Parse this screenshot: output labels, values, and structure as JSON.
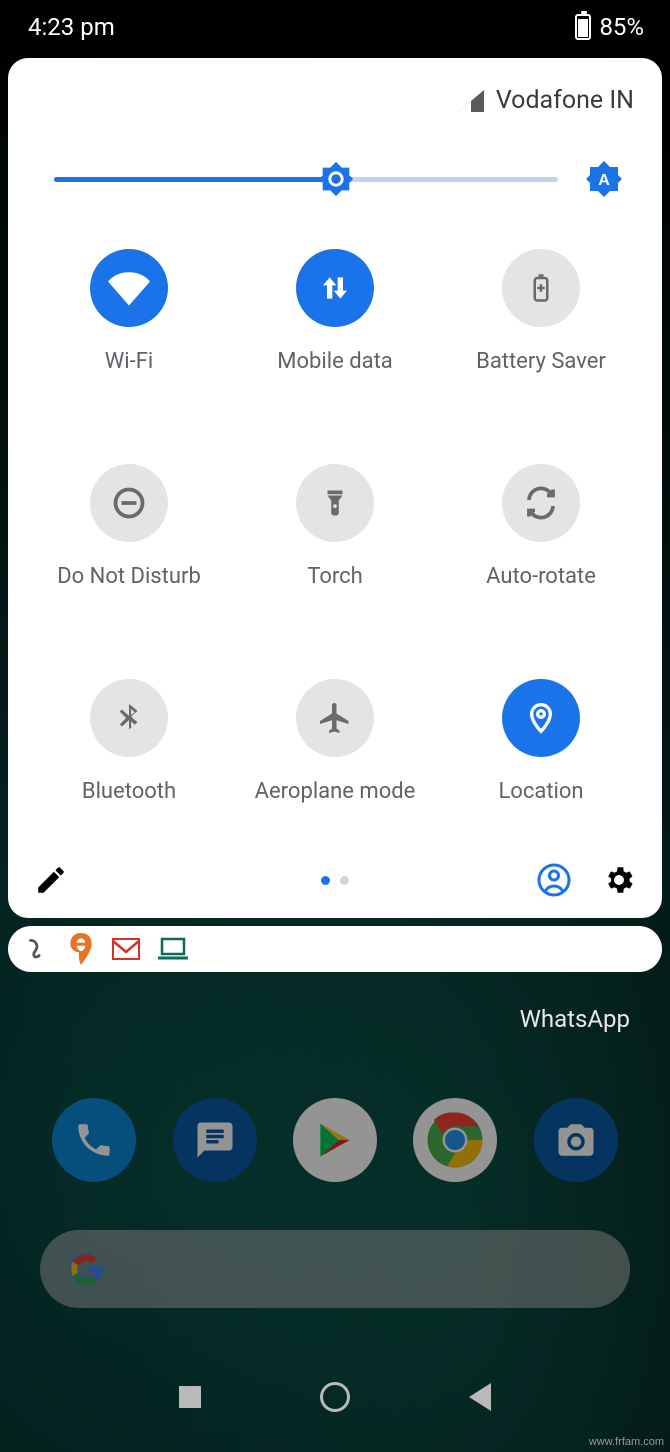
{
  "status": {
    "time": "4:23 pm",
    "battery_pct": "85%"
  },
  "carrier": "Vodafone IN",
  "brightness": {
    "percent": 56
  },
  "tiles": [
    {
      "key": "wifi",
      "label": "Wi-Fi",
      "enabled": true
    },
    {
      "key": "mobile-data",
      "label": "Mobile data",
      "enabled": true
    },
    {
      "key": "battery-saver",
      "label": "Battery Saver",
      "enabled": false
    },
    {
      "key": "dnd",
      "label": "Do Not Disturb",
      "enabled": false
    },
    {
      "key": "torch",
      "label": "Torch",
      "enabled": false
    },
    {
      "key": "auto-rotate",
      "label": "Auto-rotate",
      "enabled": false
    },
    {
      "key": "bluetooth",
      "label": "Bluetooth",
      "enabled": false
    },
    {
      "key": "airplane",
      "label": "Aeroplane mode",
      "enabled": false
    },
    {
      "key": "location",
      "label": "Location",
      "enabled": true
    }
  ],
  "page_indicator": {
    "pages": 2,
    "active": 0
  },
  "notification_icons": [
    "swirl-icon",
    "swiggy-icon",
    "gmail-icon",
    "laptop-icon"
  ],
  "home": {
    "whatsapp_label": "WhatsApp",
    "dock": [
      "phone",
      "messages",
      "play-store",
      "chrome",
      "camera"
    ]
  },
  "watermark": "www.frfam.com"
}
